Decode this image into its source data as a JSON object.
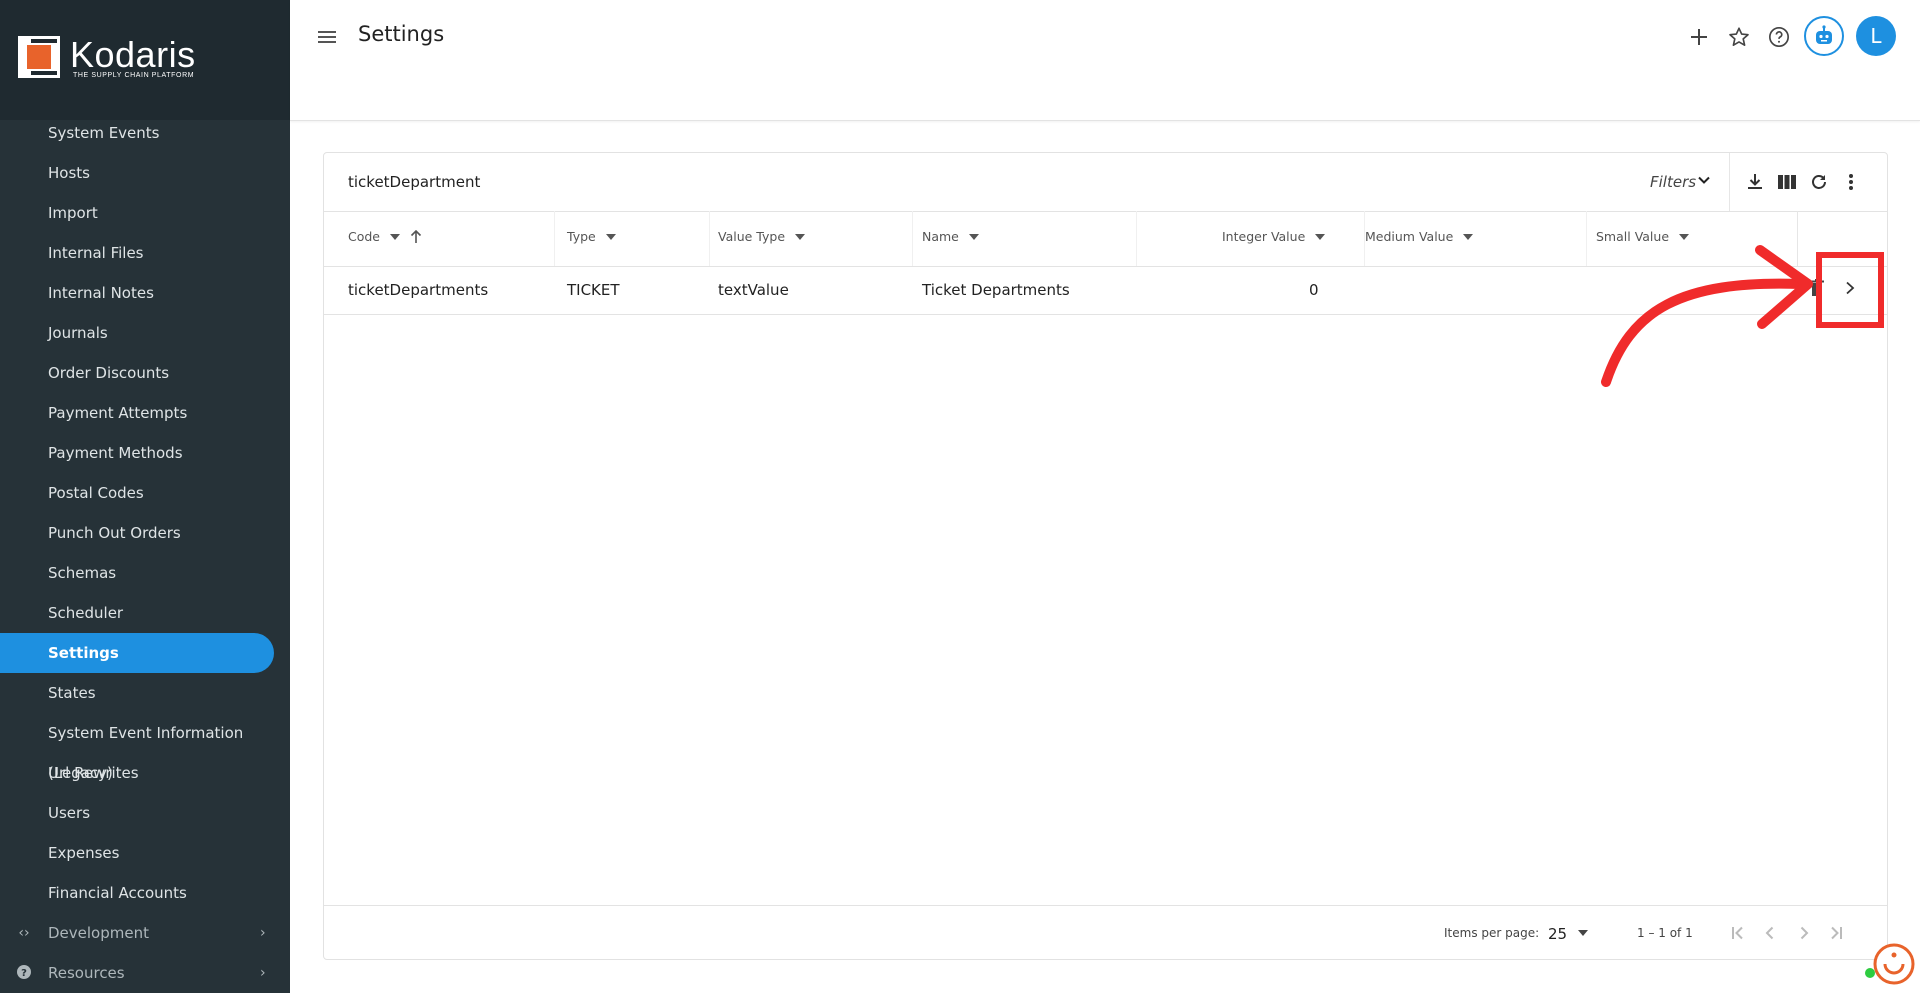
{
  "brand": {
    "name": "Kodaris",
    "tagline": "THE SUPPLY CHAIN PLATFORM"
  },
  "sidebar": {
    "items": [
      {
        "label": "System Events"
      },
      {
        "label": "Hosts"
      },
      {
        "label": "Import"
      },
      {
        "label": "Internal Files"
      },
      {
        "label": "Internal Notes"
      },
      {
        "label": "Journals"
      },
      {
        "label": "Order Discounts"
      },
      {
        "label": "Payment Attempts"
      },
      {
        "label": "Payment Methods"
      },
      {
        "label": "Postal Codes"
      },
      {
        "label": "Punch Out Orders"
      },
      {
        "label": "Schemas"
      },
      {
        "label": "Scheduler"
      },
      {
        "label": "Settings",
        "active": true
      },
      {
        "label": "States"
      },
      {
        "label": "System Event Information (Legacy)"
      },
      {
        "label": "Url Rewrites"
      },
      {
        "label": "Users"
      },
      {
        "label": "Expenses"
      },
      {
        "label": "Financial Accounts"
      }
    ],
    "groups": [
      {
        "label": "Development",
        "icon": "code-icon"
      },
      {
        "label": "Resources",
        "icon": "help-circle-icon"
      }
    ]
  },
  "header": {
    "title": "Settings",
    "avatar_initial": "L",
    "accent": "#1e90e0"
  },
  "table": {
    "title": "ticketDepartment",
    "filters_label": "Filters",
    "columns": [
      {
        "label": "Code"
      },
      {
        "label": "Type"
      },
      {
        "label": "Value Type"
      },
      {
        "label": "Name"
      },
      {
        "label": "Integer Value"
      },
      {
        "label": "Medium Value"
      },
      {
        "label": "Small Value"
      }
    ],
    "rows": [
      {
        "code": "ticketDepartments",
        "type": "TICKET",
        "value_type": "textValue",
        "name": "Ticket Departments",
        "integer_value": "0",
        "medium_value": "",
        "small_value": ""
      }
    ],
    "paginator": {
      "items_per_page_label": "Items per page:",
      "items_per_page": "25",
      "range_label": "1 – 1 of 1"
    }
  },
  "annotation_color": "#f02b2b"
}
